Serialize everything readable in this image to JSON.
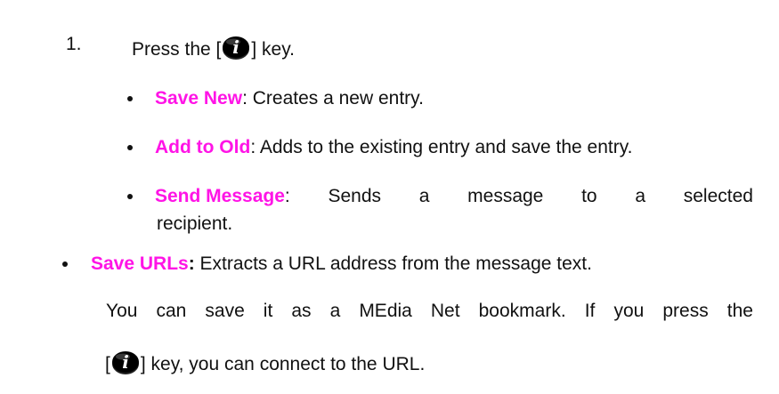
{
  "step": {
    "number": "1.",
    "text_before": "Press the [",
    "text_after": "] key."
  },
  "options": [
    {
      "label": "Save New",
      "text": ": Creates a new entry."
    },
    {
      "label": "Add to Old",
      "text": ": Adds to the existing entry and save the entry."
    },
    {
      "label": "Send Message",
      "words": [
        ":",
        "Sends",
        "a",
        "message",
        "to",
        "a",
        "selected"
      ],
      "continuation": "recipient."
    }
  ],
  "save_urls": {
    "label": "Save URLs",
    "colon": ":",
    "text": " Extracts a URL address from the message text.",
    "line2_words": [
      "You",
      "can",
      "save",
      "it",
      "as",
      "a",
      "MEdia",
      "Net",
      "bookmark.",
      "If",
      "you",
      "press",
      "the"
    ],
    "line3_before": "[",
    "line3_after": "] key, you can connect to the URL."
  },
  "icons": {
    "key": "info-i-key-icon"
  },
  "colors": {
    "highlight": "#ff14e6",
    "text": "#111111"
  }
}
